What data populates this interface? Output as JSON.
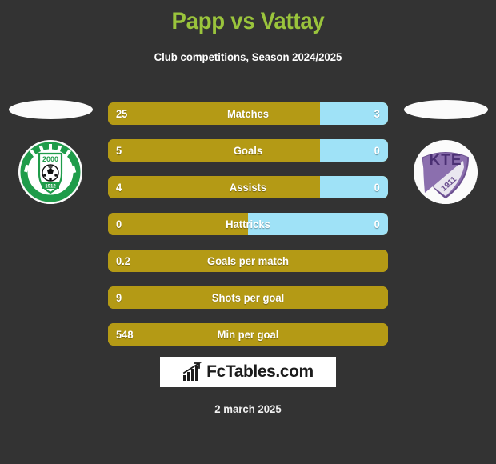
{
  "header": {
    "title": "Papp vs Vattay",
    "subtitle": "Club competitions, Season 2024/2025",
    "title_color": "#9ac43c",
    "subtitle_color": "#ffffff"
  },
  "background_color": "#333333",
  "teams": {
    "home": {
      "crest_name": "green-club-crest",
      "crest_year": "2000",
      "crest_founded": "1912",
      "crest_primary_color": "#1f9c4a",
      "crest_background_color": "#fbfbfb"
    },
    "away": {
      "crest_name": "kte-club-crest",
      "crest_initials": "KTE",
      "crest_year": "1911",
      "crest_primary_color": "#8b6fae",
      "crest_background_color": "#fbfbfb"
    }
  },
  "chart_data": {
    "type": "bar",
    "title": "Papp vs Vattay",
    "subtitle": "Club competitions, Season 2024/2025",
    "categories": [
      "Matches",
      "Goals",
      "Assists",
      "Hattricks",
      "Goals per match",
      "Shots per goal",
      "Min per goal"
    ],
    "series": [
      {
        "name": "Papp",
        "values": [
          "25",
          "5",
          "4",
          "0",
          "0.2",
          "9",
          "548"
        ],
        "color": "#b49a15"
      },
      {
        "name": "Vattay",
        "values": [
          "3",
          "0",
          "0",
          "0",
          null,
          null,
          null
        ],
        "color": "#9fe2f7"
      }
    ],
    "left_fill_percent": [
      75.7,
      75.7,
      75.7,
      50,
      100,
      100,
      100
    ],
    "grid": false,
    "legend": "none"
  },
  "rows": [
    {
      "label": "Matches",
      "left": "25",
      "right": "3",
      "left_pct": 75.7,
      "has_right": true
    },
    {
      "label": "Goals",
      "left": "5",
      "right": "0",
      "left_pct": 75.7,
      "has_right": true
    },
    {
      "label": "Assists",
      "left": "4",
      "right": "0",
      "left_pct": 75.7,
      "has_right": true
    },
    {
      "label": "Hattricks",
      "left": "0",
      "right": "0",
      "left_pct": 50,
      "has_right": true
    },
    {
      "label": "Goals per match",
      "left": "0.2",
      "right": "",
      "left_pct": 100,
      "has_right": false
    },
    {
      "label": "Shots per goal",
      "left": "9",
      "right": "",
      "left_pct": 100,
      "has_right": false
    },
    {
      "label": "Min per goal",
      "left": "548",
      "right": "",
      "left_pct": 100,
      "has_right": false
    }
  ],
  "footer": {
    "logo_text": "FcTables.com",
    "logo_icon": "bar-chart-trend-icon",
    "date": "2 march 2025"
  },
  "colors": {
    "bar_left": "#b49a15",
    "bar_right": "#9fe2f7",
    "text": "#ffffff"
  }
}
